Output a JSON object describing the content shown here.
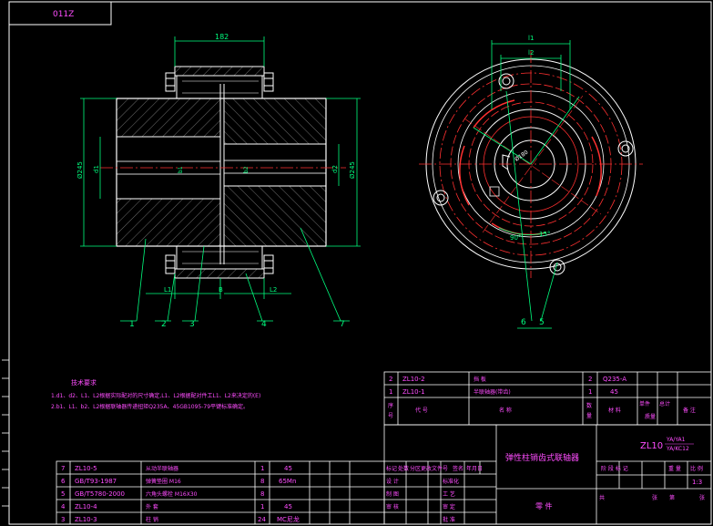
{
  "corner_tag": "011Z",
  "left_view": {
    "dim_top": "182",
    "dim_left_dia": "Ø245",
    "dim_right_dia": "Ø245",
    "d1": "d1",
    "d2": "d2",
    "b1": "b1",
    "b2": "b2",
    "L1": "L1",
    "L2": "L2",
    "B": "B",
    "balloons": [
      "1",
      "2",
      "3",
      "4",
      "7"
    ]
  },
  "right_view": {
    "dim_l1": "l1",
    "dim_l2": "l2",
    "center_dia": "Ø180",
    "angle_a": "90°",
    "angle_b": "15°",
    "balloons": [
      "6",
      "5"
    ]
  },
  "tech_notes": {
    "title": "技术要求",
    "line1": "1.d1、d2、L1、L2根据实际配对的尺寸确定,L1、L2根据配对件工L1、L2来决定的(E)",
    "line2": "2.b1、L1、b2、L2根据联轴器传递扭矩Q235A、45GB1095-79平键标准确定。"
  },
  "parts_list_upper": [
    {
      "no": "2",
      "code": "ZL10-2",
      "name": "挡  板",
      "qty": "2",
      "material": "Q235-A"
    },
    {
      "no": "1",
      "code": "ZL10-1",
      "name": "半联轴器(带齿)",
      "qty": "1",
      "material": "45"
    }
  ],
  "parts_header": {
    "no": "序\n号",
    "code": "代          号",
    "name": "名          称",
    "qty": "数\n量",
    "material": "材  料",
    "unit": "单件",
    "total": "总计",
    "mass": "质量",
    "remark": "备  注"
  },
  "parts_list_lower": [
    {
      "no": "7",
      "code": "ZL10-5",
      "name": "从动半联轴器",
      "qty": "1",
      "material": "45"
    },
    {
      "no": "6",
      "code": "GB/T93-1987",
      "name": "弹簧垫圈 M16",
      "qty": "8",
      "material": "65Mn"
    },
    {
      "no": "5",
      "code": "GB/T5780-2000",
      "name": "六角头螺栓 M16X30",
      "qty": "8",
      "material": ""
    },
    {
      "no": "4",
      "code": "ZL10-4",
      "name": "外  套",
      "qty": "1",
      "material": "45"
    },
    {
      "no": "3",
      "code": "ZL10-3",
      "name": "柱  销",
      "qty": "24",
      "material": "MC尼龙"
    }
  ],
  "title_block": {
    "title": "弹性柱销齿式联轴器",
    "code": "ZL10",
    "spec1": "YA/YA1",
    "spec2": "YA/KC12",
    "mark_label": "标记",
    "count_label": "处数",
    "zone_label": "分区",
    "change_doc": "更改文件号",
    "sign": "签名",
    "date": "年月日",
    "design": "设  计",
    "standard": "标准化",
    "drawing": "制  图",
    "process": "工  艺",
    "review": "审  核",
    "check": "审  定",
    "approve": "批  准",
    "part_label": "零  件",
    "stage": "阶  段  标  记",
    "weight": "重  量",
    "scale": "比  例",
    "scale_value": "1:3",
    "sheet_total": "共",
    "sheet": "张",
    "sheet_no": "第",
    "sheet2": "张"
  }
}
